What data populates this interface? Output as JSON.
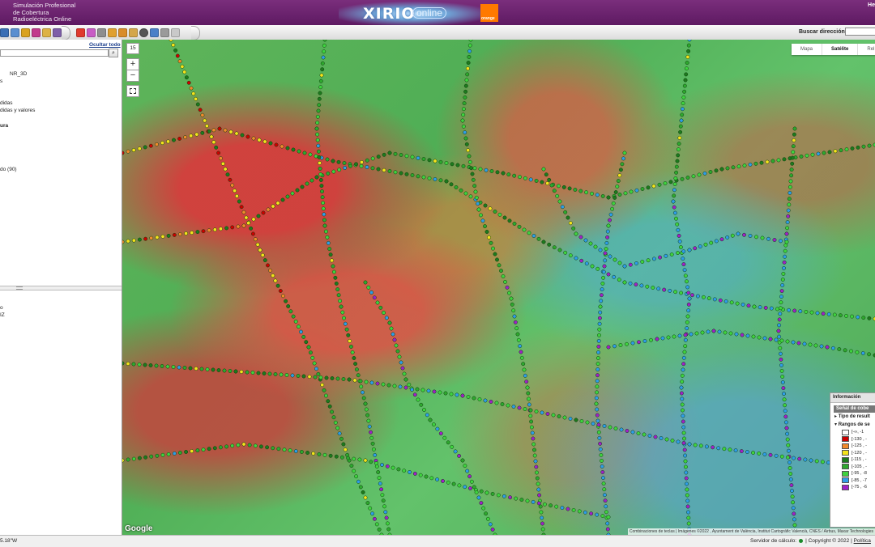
{
  "header": {
    "app_title_lines": [
      "Simulación Profesional",
      "de Cobertura",
      "Radioeléctrica Online"
    ],
    "logo_text": "XIRIO",
    "logo_suffix": "online",
    "brand_text": "orange",
    "top_right": "He"
  },
  "toolbar": {
    "search_label": "Buscar dirección:",
    "search_value": ""
  },
  "sidebar": {
    "hide_all": "Ocultar todo",
    "tree_items": [
      {
        "label": "NR_3D",
        "bold": false
      },
      {
        "label": "s",
        "bold": false
      },
      {
        "label": "didas",
        "bold": false
      },
      {
        "label": "didas y valores",
        "bold": false
      },
      {
        "label": "ura",
        "bold": true
      },
      {
        "label": "do (90)",
        "bold": false
      }
    ],
    "lower_items": [
      {
        "label": "o"
      },
      {
        "label": "IZ"
      }
    ]
  },
  "map": {
    "zoom_level": "15",
    "zoom_in": "+",
    "zoom_out": "−",
    "map_types": [
      {
        "label": "Mapa",
        "active": false
      },
      {
        "label": "Satélite",
        "active": true
      },
      {
        "label": "Rel",
        "active": false
      }
    ],
    "google_text": "Google",
    "attribution": "Combinaciones de teclas | Imágenes ©2022 , Ayuntament de València, Institut Cartogràfic Valencià, CNES / Airbus, Maxar Technologies"
  },
  "legend": {
    "title": "Información",
    "subtitle": "Señal de cobe",
    "section_result": "Tipo de result",
    "section_ranges": "Rangos de se",
    "ranges": [
      {
        "label": "[-∞, -1",
        "color": "#ffffff"
      },
      {
        "label": "[-130 , -",
        "color": "#cc0000"
      },
      {
        "label": "[-125 , -",
        "color": "#f08a2c"
      },
      {
        "label": "[-120 , -",
        "color": "#f5e31c"
      },
      {
        "label": "[-115 , -",
        "color": "#1d7a1d"
      },
      {
        "label": "[-105 , -",
        "color": "#2ea82e"
      },
      {
        "label": "[-95 , -8",
        "color": "#3fd23f"
      },
      {
        "label": "[-85 , -7",
        "color": "#2f9de8"
      },
      {
        "label": "[-75 , -6",
        "color": "#a020c8"
      }
    ]
  },
  "status": {
    "coords": "5.18\"W",
    "server_label": "Servidor de cálculo:",
    "copyright": "Copyright © 2022",
    "policy": "Política"
  }
}
